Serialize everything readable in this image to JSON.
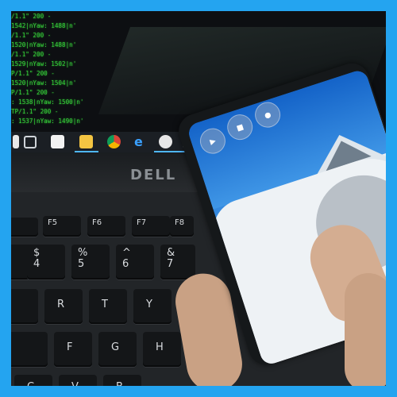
{
  "terminal": {
    "lines": [
      "/1.1\" 200 -",
      "1542|nYaw: 1488|n'",
      "/1.1\" 200 -",
      "1520|nYaw: 1488|n'",
      "/1.1\" 200 -",
      "1529|nYaw: 1502|n'",
      "P/1.1\" 200 -",
      "1520|nYaw: 1504|n'",
      "P/1.1\" 200 -",
      ": 1538|nYaw: 1500|n'",
      "TP/1.1\" 200 -",
      ": 1537|nYaw: 1490|n'"
    ]
  },
  "taskbar": {
    "icons": [
      "task-view-icon",
      "store-icon",
      "file-explorer-icon",
      "chrome-icon",
      "edge-icon",
      "app-icon",
      "terminal-window-icon",
      "python-icon"
    ]
  },
  "laptop": {
    "brand": "DELL"
  },
  "keyboard": {
    "fn_keys": [
      "F5",
      "F6",
      "F7",
      "F8"
    ],
    "row_numbers": [
      "$\n4",
      "%\n5",
      "^\n6",
      "&\n7"
    ],
    "row_letters_1": [
      "R",
      "T",
      "Y"
    ],
    "row_letters_2": [
      "F",
      "G",
      "H"
    ],
    "row_letters_3": [
      "C",
      "V",
      "B"
    ]
  },
  "phone_app": {
    "buttons": [
      "video-icon",
      "folder-icon",
      "record-icon"
    ]
  }
}
